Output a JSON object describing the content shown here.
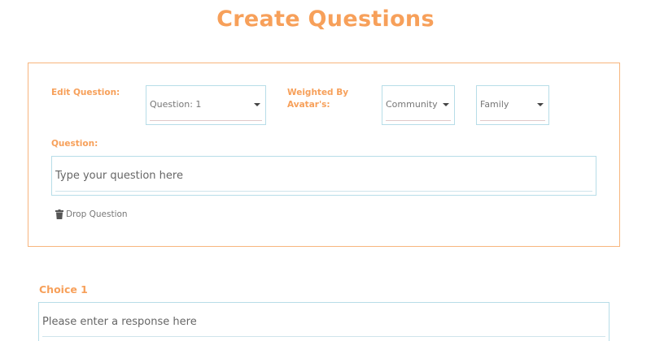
{
  "page": {
    "title": "Create Questions"
  },
  "question_card": {
    "edit_question_label": "Edit Question:",
    "question_select": {
      "selected": "Question: 1"
    },
    "weighted_label_line1": "Weighted By",
    "weighted_label_line2": "Avatar's:",
    "avatar_select_1": {
      "selected": "Community"
    },
    "avatar_select_2": {
      "selected": "Family"
    },
    "question_label": "Question:",
    "question_input": {
      "placeholder": "Type your question here",
      "value": ""
    },
    "drop_question_label": "Drop Question"
  },
  "choices": [
    {
      "label": "Choice 1",
      "placeholder": "Please enter a response here",
      "value": ""
    }
  ],
  "colors": {
    "accent": "#f7a05a",
    "border_blue": "#b7dde8",
    "card_border": "#f7b57d"
  },
  "icons": {
    "drop": "trash-icon",
    "dropdown": "caret-down-icon"
  }
}
